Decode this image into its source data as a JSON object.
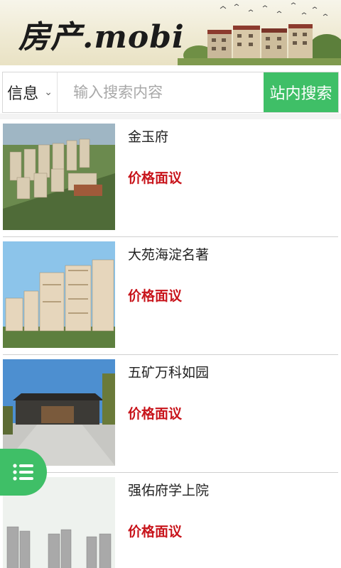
{
  "header": {
    "logo_text": "房产.mobi"
  },
  "search": {
    "category_label": "信息",
    "placeholder": "输入搜索内容",
    "value": "",
    "button_label": "站内搜索"
  },
  "listings": [
    {
      "name": "金玉府",
      "price": "价格面议"
    },
    {
      "name": "大苑海淀名著",
      "price": "价格面议"
    },
    {
      "name": "五矿万科如园",
      "price": "价格面议"
    },
    {
      "name": "强佑府学上院",
      "price": "价格面议"
    }
  ],
  "colors": {
    "accent": "#3fbf67",
    "price": "#c8141b"
  },
  "icons": {
    "menu": "menu-icon",
    "dropdown": "chevron-down-icon"
  }
}
